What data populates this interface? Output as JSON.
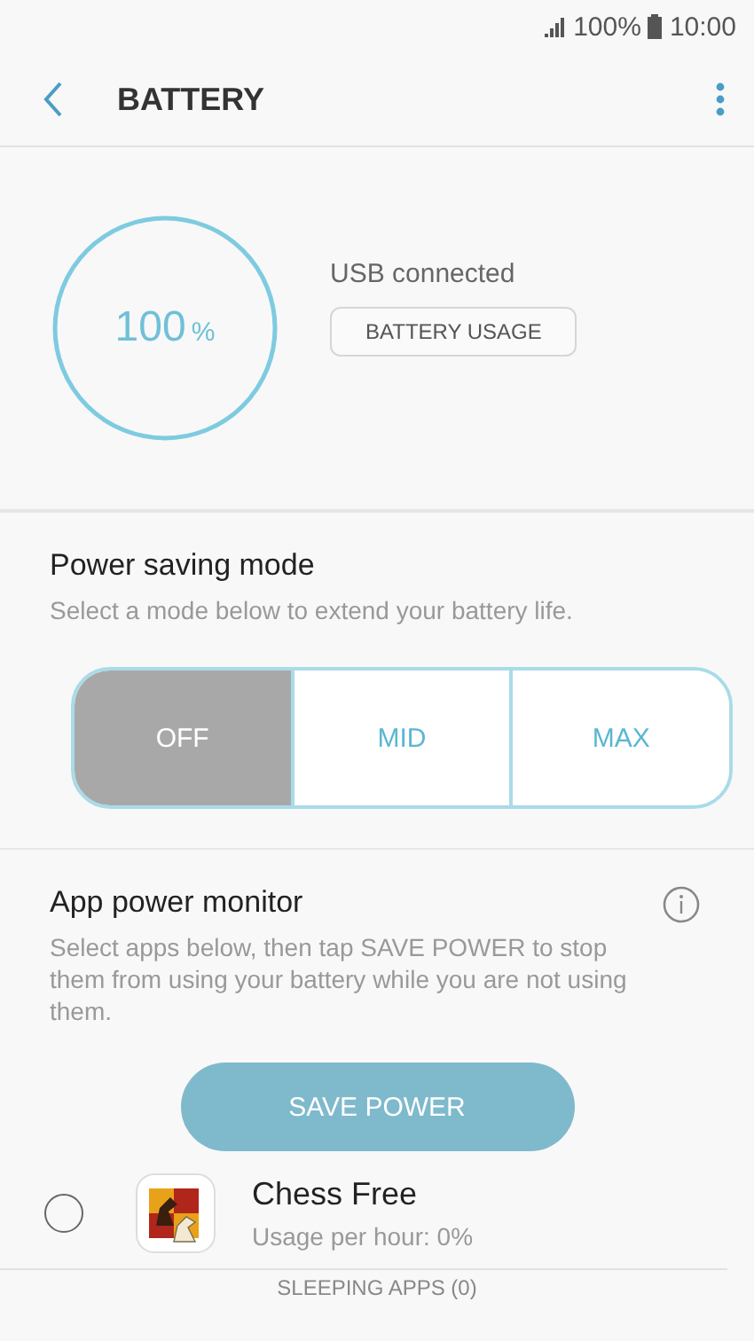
{
  "status_bar": {
    "battery": "100%",
    "time": "10:00"
  },
  "header": {
    "title": "BATTERY"
  },
  "battery": {
    "percent": "100",
    "unit": "%",
    "status": "USB connected",
    "usage_button": "BATTERY USAGE"
  },
  "power_saving": {
    "title": "Power saving mode",
    "subtitle": "Select a mode below to extend your battery life.",
    "modes": [
      {
        "label": "OFF",
        "selected": true
      },
      {
        "label": "MID",
        "selected": false
      },
      {
        "label": "MAX",
        "selected": false
      }
    ]
  },
  "app_power_monitor": {
    "title": "App power monitor",
    "description": "Select apps below, then tap SAVE POWER to stop them from using your battery while you are not using them.",
    "button": "SAVE POWER",
    "button_disabled": true,
    "apps": [
      {
        "name": "Chess Free",
        "usage": "Usage per hour: 0%",
        "checked": false
      }
    ],
    "sleeping_apps": "SLEEPING APPS (0)"
  }
}
